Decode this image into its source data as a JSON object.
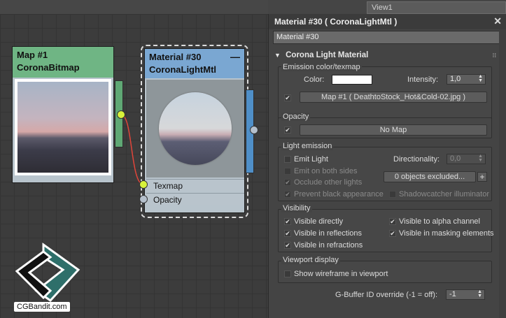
{
  "canvas": {
    "view_tab": "View1",
    "bitmap_node": {
      "title": "Map #1",
      "subtitle": "CoronaBitmap"
    },
    "material_node": {
      "title": "Material #30",
      "subtitle": "CoronaLightMtl",
      "collapse": "—",
      "slots": [
        "Texmap",
        "Opacity"
      ]
    },
    "watermark": "CGBandit.com"
  },
  "panel": {
    "title": "Material #30  ( CoronaLightMtl )",
    "close": "✕",
    "name_value": "Material #30",
    "rollout": "Corona Light Material",
    "emission": {
      "group": "Emission color/texmap",
      "color_label": "Color:",
      "intensity_label": "Intensity:",
      "intensity_value": "1,0",
      "map_button": "Map #1 ( DeathtoStock_Hot&Cold-02.jpg )"
    },
    "opacity": {
      "group": "Opacity",
      "map_button": "No Map"
    },
    "light_emission": {
      "group": "Light emission",
      "emit_light": "Emit Light",
      "directionality_label": "Directionality:",
      "directionality_value": "0,0",
      "emit_both_sides": "Emit on both sides",
      "excluded_button": "0 objects excluded...",
      "plus": "+",
      "occlude": "Occlude other lights",
      "prevent_black": "Prevent black appearance",
      "shadowcatcher": "Shadowcatcher illuminator"
    },
    "visibility": {
      "group": "Visibility",
      "directly": "Visible directly",
      "reflections": "Visible in reflections",
      "refractions": "Visible in refractions",
      "alpha": "Visible to alpha channel",
      "masking": "Visible in masking elements"
    },
    "viewport": {
      "group": "Viewport display",
      "wireframe": "Show wireframe in viewport"
    },
    "gbuffer": {
      "label": "G-Buffer ID override (-1 = off):",
      "value": "-1"
    },
    "check_glyph": "✔"
  },
  "colors": {
    "bitmap_header": "#6fb584",
    "material_header": "#7aa7d2",
    "socket_active": "#d8f23a",
    "wire": "#e0453a",
    "panel_bg": "#444444"
  }
}
